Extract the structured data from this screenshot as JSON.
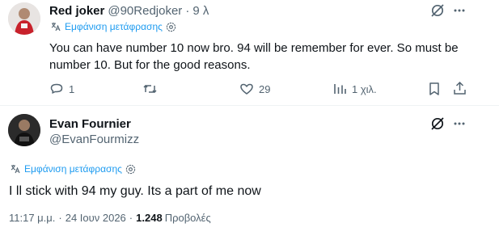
{
  "reply": {
    "display_name": "Red joker",
    "handle": "@90Redjoker",
    "separator": "·",
    "time": "9 λ",
    "translate_label": "Εμφάνιση μετάφρασης",
    "text_line1": "You can have number 10 now bro. 94 will be remember for ever. So must be",
    "text_line2": "number 10. But for the good reasons.",
    "actions": {
      "replies": "1",
      "retweets": "",
      "likes": "29",
      "views": "1 χιλ."
    }
  },
  "main": {
    "display_name": "Evan Fournier",
    "handle": "@EvanFourmizz",
    "translate_label": "Εμφάνιση μετάφρασης",
    "text": "I ll stick with 94 my guy. Its a part of me now",
    "time": "11:17 μ.μ.",
    "date": "24 Ιουν 2026",
    "views_count": "1.248",
    "views_label": "Προβολές",
    "dot": "·"
  },
  "colors": {
    "accent": "#1d9bf0",
    "muted": "#536471",
    "text": "#0f1419"
  }
}
